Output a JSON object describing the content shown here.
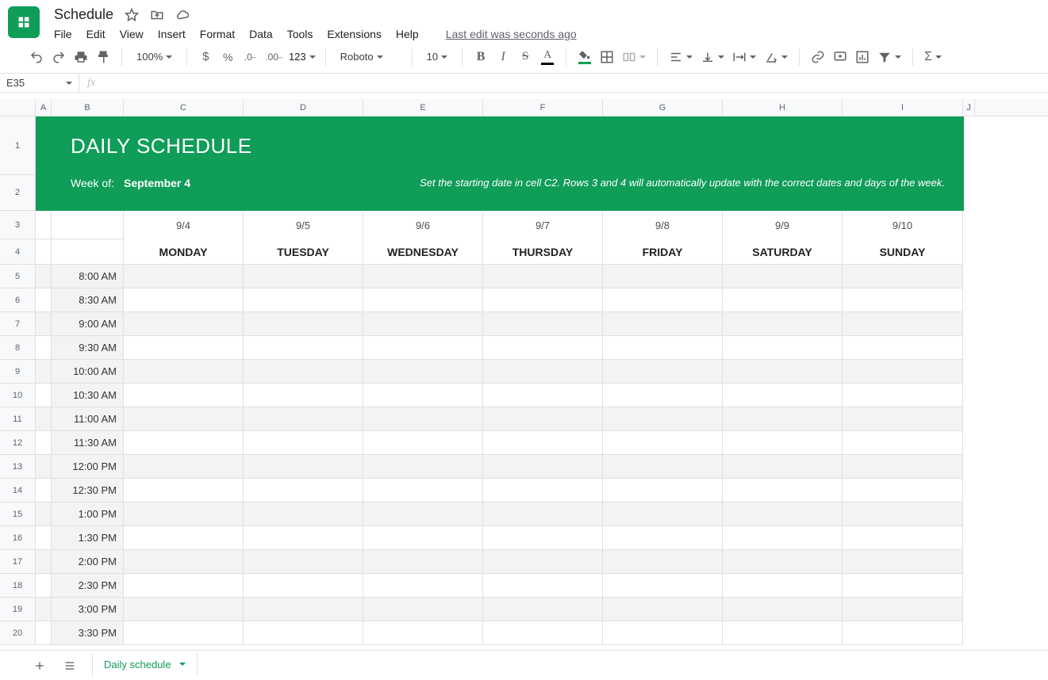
{
  "doc": {
    "title": "Schedule"
  },
  "menus": {
    "file": "File",
    "edit": "Edit",
    "view": "View",
    "insert": "Insert",
    "format": "Format",
    "data": "Data",
    "tools": "Tools",
    "extensions": "Extensions",
    "help": "Help",
    "last_edit": "Last edit was seconds ago"
  },
  "toolbar": {
    "zoom": "100%",
    "font": "Roboto",
    "font_size": "10",
    "num_fmt": "123"
  },
  "fx": {
    "namebox": "E35",
    "formula": ""
  },
  "cols": [
    "A",
    "B",
    "C",
    "D",
    "E",
    "F",
    "G",
    "H",
    "I",
    "J"
  ],
  "banner": {
    "title": "DAILY SCHEDULE",
    "week_of_label": "Week of:",
    "week_of": "September 4",
    "tip": "Set the starting date in cell C2. Rows 3 and 4 will automatically update with the correct dates and days of the week."
  },
  "dates": [
    "9/4",
    "9/5",
    "9/6",
    "9/7",
    "9/8",
    "9/9",
    "9/10"
  ],
  "days": [
    "MONDAY",
    "TUESDAY",
    "WEDNESDAY",
    "THURSDAY",
    "FRIDAY",
    "SATURDAY",
    "SUNDAY"
  ],
  "rownums_header": [
    "1",
    "2",
    "3",
    "4"
  ],
  "times": [
    "8:00 AM",
    "8:30 AM",
    "9:00 AM",
    "9:30 AM",
    "10:00 AM",
    "10:30 AM",
    "11:00 AM",
    "11:30 AM",
    "12:00 PM",
    "12:30 PM",
    "1:00 PM",
    "1:30 PM",
    "2:00 PM",
    "2:30 PM",
    "3:00 PM",
    "3:30 PM"
  ],
  "tab": {
    "name": "Daily schedule"
  }
}
